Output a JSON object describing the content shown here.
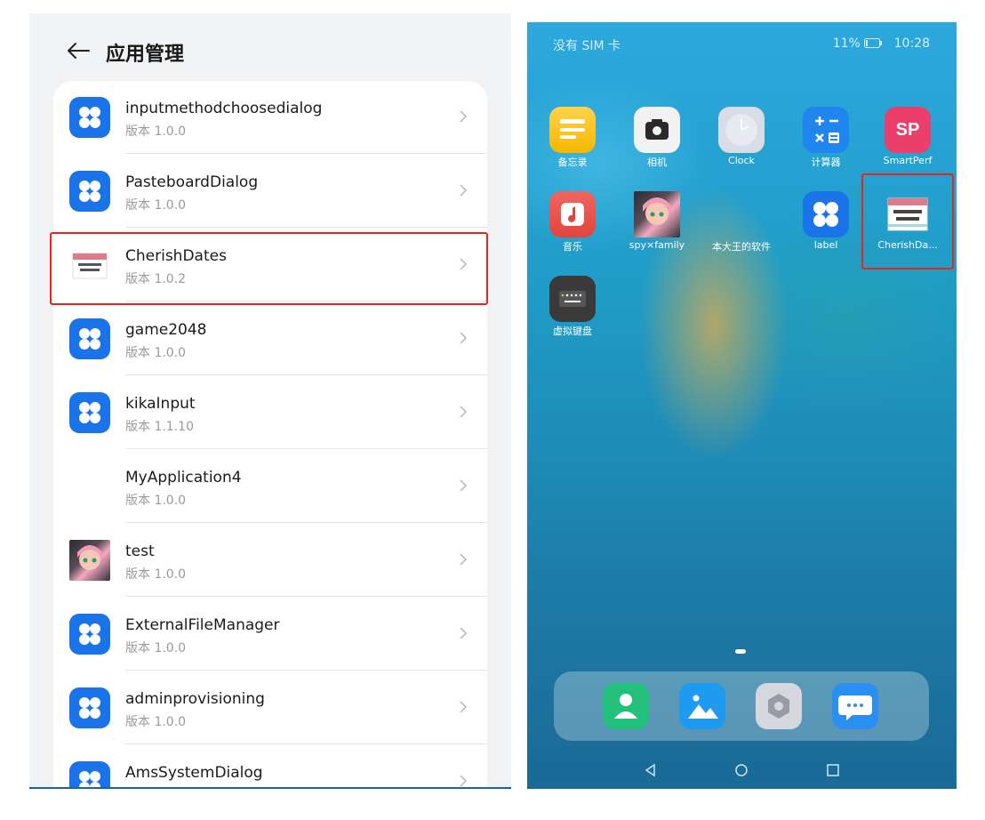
{
  "left": {
    "title": "应用管理",
    "apps": [
      {
        "name": "inputmethodchoosedialog",
        "version": "版本 1.0.0",
        "icon": "blue-grid-icon"
      },
      {
        "name": "PasteboardDialog",
        "version": "版本 1.0.0",
        "icon": "blue-grid-icon"
      },
      {
        "name": "CherishDates",
        "version": "版本 1.0.2",
        "icon": "cherish-dates-icon"
      },
      {
        "name": "game2048",
        "version": "版本 1.0.0",
        "icon": "blue-grid-icon"
      },
      {
        "name": "kikaInput",
        "version": "版本 1.1.10",
        "icon": "blue-grid-icon"
      },
      {
        "name": "MyApplication4",
        "version": "版本 1.0.0",
        "icon": "none"
      },
      {
        "name": "test",
        "version": "版本 1.0.0",
        "icon": "anime-avatar-icon"
      },
      {
        "name": "ExternalFileManager",
        "version": "版本 1.0.0",
        "icon": "blue-grid-icon"
      },
      {
        "name": "adminprovisioning",
        "version": "版本 1.0.0",
        "icon": "blue-grid-icon"
      },
      {
        "name": "AmsSystemDialog",
        "version": "",
        "icon": "blue-grid-icon"
      }
    ]
  },
  "right": {
    "status": {
      "carrier": "没有 SIM 卡",
      "battery": "11%",
      "time": "10:28"
    },
    "apps": [
      {
        "label": "备忘录",
        "icon": "notes-icon"
      },
      {
        "label": "相机",
        "icon": "camera-icon"
      },
      {
        "label": "Clock",
        "icon": "clock-icon"
      },
      {
        "label": "计算器",
        "icon": "calculator-icon"
      },
      {
        "label": "SmartPerf",
        "icon": "smartperf-icon",
        "badge": "SP"
      },
      {
        "label": "音乐",
        "icon": "music-icon"
      },
      {
        "label": "spy×family",
        "icon": "anime-avatar-icon"
      },
      {
        "label": "本大王的软件",
        "icon": "none"
      },
      {
        "label": "label",
        "icon": "blue-grid-icon"
      },
      {
        "label": "CherishDa...",
        "icon": "cherish-dates-icon"
      },
      {
        "label": "虚拟键盘",
        "icon": "keyboard-icon"
      }
    ],
    "dock": [
      "contacts-icon",
      "gallery-icon",
      "settings-icon",
      "messages-icon"
    ]
  },
  "colors": {
    "accent": "#1a73e8",
    "highlight": "#e8241d"
  }
}
